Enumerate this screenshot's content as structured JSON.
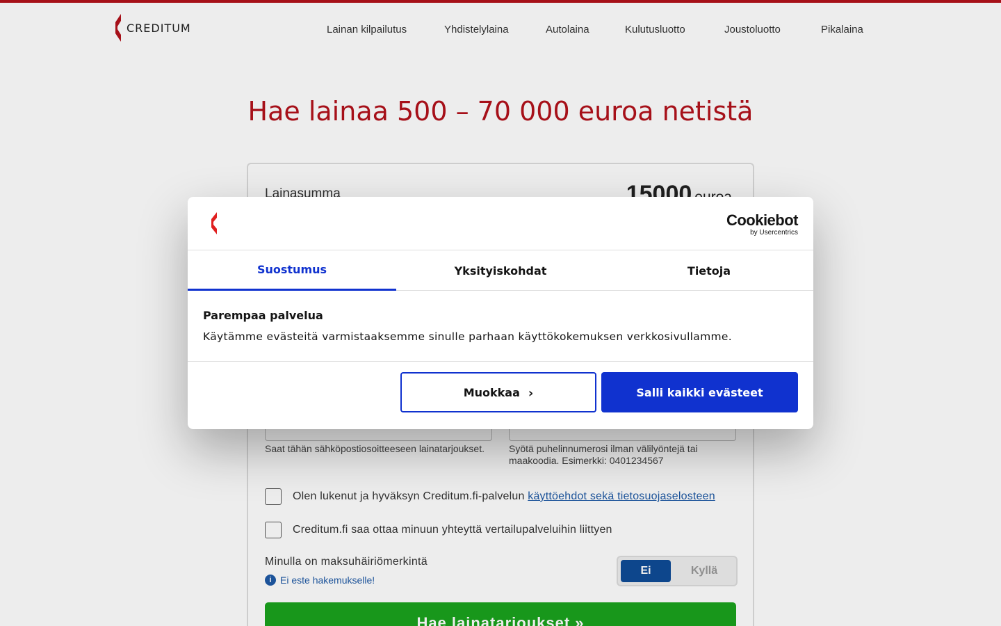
{
  "brand": {
    "name": "CREDITUM",
    "logo_icon": "creditum-logo-icon",
    "color": "#b3121b"
  },
  "nav": {
    "items": [
      {
        "label": "Lainan kilpailutus"
      },
      {
        "label": "Yhdistelylaina"
      },
      {
        "label": "Autolaina"
      },
      {
        "label": "Kulutusluotto"
      },
      {
        "label": "Joustoluotto"
      },
      {
        "label": "Pikalaina"
      }
    ]
  },
  "hero": {
    "title": "Hae lainaa 500 – 70 000 euroa netistä"
  },
  "form": {
    "amount_label": "Lainasumma",
    "amount_value": "15000",
    "amount_unit": "euroa",
    "email_help": "Saat tähän sähköpostiosoitteeseen lainatarjoukset.",
    "phone_help": "Syötä puhelinnumerosi ilman välilyöntejä tai maakoodia. Esimerkki: 0401234567",
    "terms_prefix": "Olen lukenut ja hyväksyn Creditum.fi-palvelun ",
    "terms_link": "käyttöehdot sekä tietosuojaselosteen",
    "contact_consent": "Creditum.fi saa ottaa minuun yhteyttä vertailupalveluihin liittyen",
    "payment_default_label": "Minulla on maksuhäiriömerkintä",
    "toggle_no": "Ei",
    "toggle_yes": "Kyllä",
    "toggle_selected": "Ei",
    "note_icon": "info-icon",
    "note": "Ei este hakemukselle!",
    "submit": "Hae lainatarjoukset »",
    "submit_color": "#1aa31e"
  },
  "cookie_modal": {
    "brand": "Cookiebot",
    "brand_sub": "by Usercentrics",
    "tabs": [
      {
        "label": "Suostumus",
        "active": true
      },
      {
        "label": "Yksityiskohdat",
        "active": false
      },
      {
        "label": "Tietoja",
        "active": false
      }
    ],
    "title": "Parempaa palvelua",
    "text": "Käytämme evästeitä varmistaaksemme sinulle parhaan käyttökokemuksen verkkosivullamme.",
    "customize_label": "Muokkaa",
    "customize_icon": "chevron-right-icon",
    "allow_label": "Salli kaikki evästeet",
    "accent_color": "#1032cf"
  }
}
